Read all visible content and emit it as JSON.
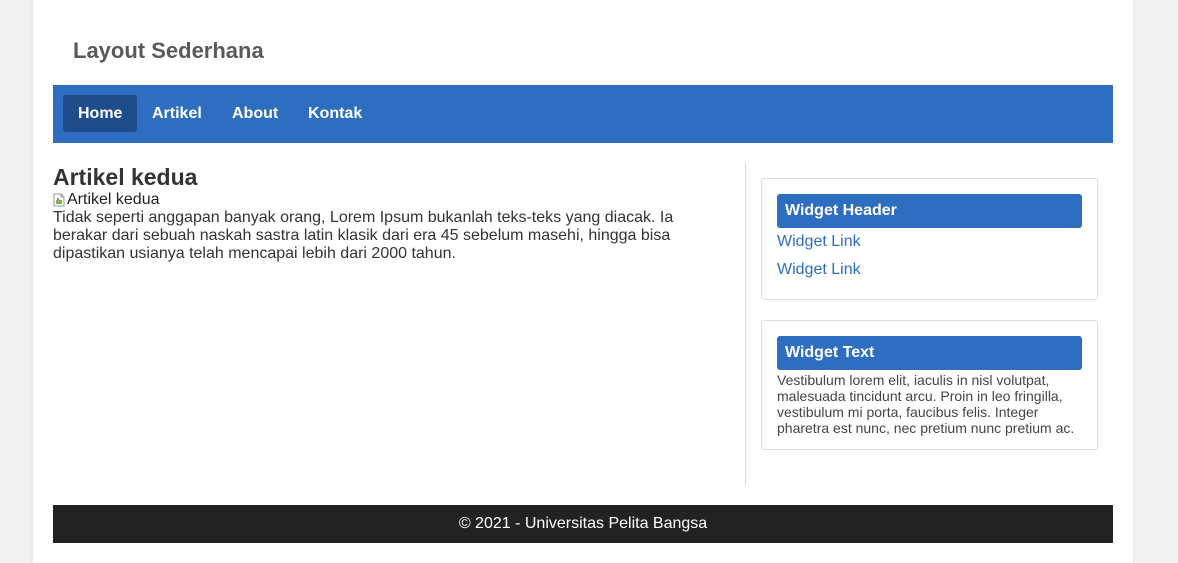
{
  "header": {
    "title": "Layout Sederhana"
  },
  "nav": {
    "items": [
      {
        "label": "Home",
        "active": true
      },
      {
        "label": "Artikel",
        "active": false
      },
      {
        "label": "About",
        "active": false
      },
      {
        "label": "Kontak",
        "active": false
      }
    ]
  },
  "article": {
    "title": "Artikel kedua",
    "image_alt": "Artikel kedua",
    "body": "Tidak seperti anggapan banyak orang, Lorem Ipsum bukanlah teks-teks yang diacak. Ia berakar dari sebuah naskah sastra latin klasik dari era 45 sebelum masehi, hingga bisa dipastikan usianya telah mencapai lebih dari 2000 tahun."
  },
  "sidebar": {
    "widget_links": {
      "header": "Widget Header",
      "links": [
        "Widget Link",
        "Widget Link"
      ]
    },
    "widget_text": {
      "header": "Widget Text",
      "body": "Vestibulum lorem elit, iaculis in nisl volutpat, malesuada tincidunt arcu. Proin in leo fringilla, vestibulum mi porta, faucibus felis. Integer pharetra est nunc, nec pretium nunc pretium ac."
    }
  },
  "footer": {
    "text": "© 2021 - Universitas Pelita Bangsa"
  },
  "colors": {
    "primary": "#2d6ec0",
    "nav_active": "#1d4d8c",
    "footer_bg": "#222222",
    "page_bg": "#f2f2f2"
  }
}
